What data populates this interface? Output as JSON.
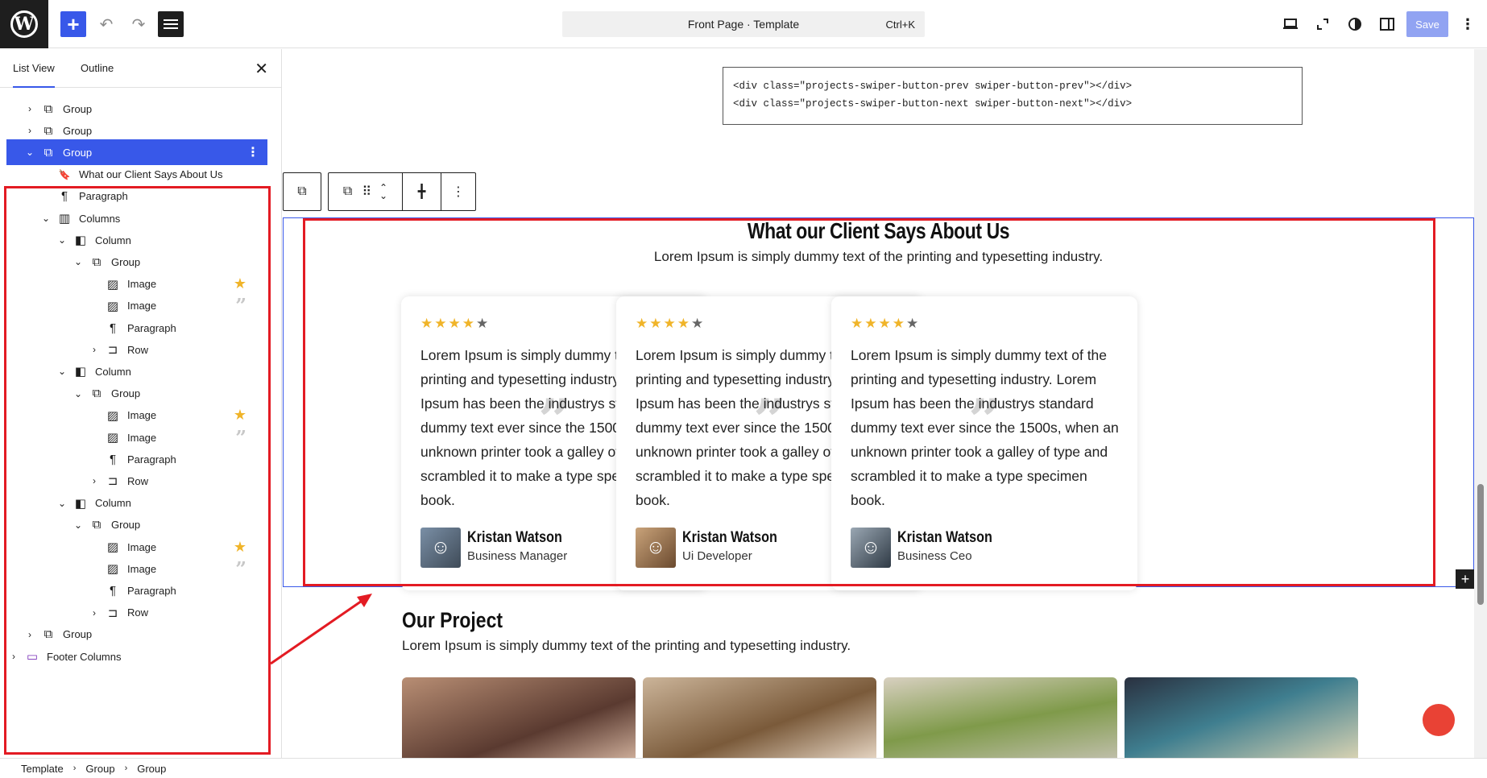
{
  "topbar": {
    "document_title": "Front Page · Template",
    "shortcut": "Ctrl+K",
    "save_label": "Save",
    "add_icon": "plus-icon",
    "undo_icon": "undo-icon",
    "redo_icon": "redo-icon"
  },
  "sidebar": {
    "tabs": [
      {
        "label": "List View"
      },
      {
        "label": "Outline"
      }
    ],
    "rows": [
      {
        "label": "Group",
        "depth": 0,
        "chev": "›",
        "icon": "group"
      },
      {
        "label": "Group",
        "depth": 0,
        "chev": "›",
        "icon": "group"
      },
      {
        "label": "Group",
        "depth": 0,
        "chev": "⌄",
        "icon": "group",
        "selected": true
      },
      {
        "label": "What our Client Says About Us",
        "depth": 1,
        "chev": "",
        "icon": "heading"
      },
      {
        "label": "Paragraph",
        "depth": 1,
        "chev": "",
        "icon": "paragraph"
      },
      {
        "label": "Columns",
        "depth": 1,
        "chev": "⌄",
        "icon": "columns"
      },
      {
        "label": "Column",
        "depth": 2,
        "chev": "⌄",
        "icon": "column"
      },
      {
        "label": "Group",
        "depth": 3,
        "chev": "⌄",
        "icon": "group"
      },
      {
        "label": "Image",
        "depth": 4,
        "chev": "",
        "icon": "image",
        "badge": "star"
      },
      {
        "label": "Image",
        "depth": 4,
        "chev": "",
        "icon": "image",
        "badge": "quote"
      },
      {
        "label": "Paragraph",
        "depth": 4,
        "chev": "",
        "icon": "paragraph"
      },
      {
        "label": "Row",
        "depth": 4,
        "chev": "›",
        "icon": "row"
      },
      {
        "label": "Column",
        "depth": 2,
        "chev": "⌄",
        "icon": "column"
      },
      {
        "label": "Group",
        "depth": 3,
        "chev": "⌄",
        "icon": "group"
      },
      {
        "label": "Image",
        "depth": 4,
        "chev": "",
        "icon": "image",
        "badge": "star"
      },
      {
        "label": "Image",
        "depth": 4,
        "chev": "",
        "icon": "image",
        "badge": "quote"
      },
      {
        "label": "Paragraph",
        "depth": 4,
        "chev": "",
        "icon": "paragraph"
      },
      {
        "label": "Row",
        "depth": 4,
        "chev": "›",
        "icon": "row"
      },
      {
        "label": "Column",
        "depth": 2,
        "chev": "⌄",
        "icon": "column"
      },
      {
        "label": "Group",
        "depth": 3,
        "chev": "⌄",
        "icon": "group"
      },
      {
        "label": "Image",
        "depth": 4,
        "chev": "",
        "icon": "image",
        "badge": "star"
      },
      {
        "label": "Image",
        "depth": 4,
        "chev": "",
        "icon": "image",
        "badge": "quote"
      },
      {
        "label": "Paragraph",
        "depth": 4,
        "chev": "",
        "icon": "paragraph"
      },
      {
        "label": "Row",
        "depth": 4,
        "chev": "›",
        "icon": "row"
      },
      {
        "label": "Group",
        "depth": 0,
        "chev": "›",
        "icon": "group"
      },
      {
        "label": "Footer Columns",
        "depth": -1,
        "chev": "›",
        "icon": "template-part"
      }
    ]
  },
  "breadcrumb": [
    "Template",
    "Group",
    "Group"
  ],
  "canvas": {
    "code_lines": [
      "<div class=\"projects-swiper-button-prev swiper-button-prev\"></div>",
      "<div class=\"projects-swiper-button-next swiper-button-next\"></div>"
    ],
    "testimonials": {
      "title": "What our Client Says About Us",
      "subtitle": "Lorem Ipsum is simply dummy text of the printing and typesetting industry.",
      "cards": [
        {
          "rating": 4,
          "text": "Lorem Ipsum is simply dummy text of the printing and typesetting industry. Lorem Ipsum has been the industrys standard dummy text ever since the 1500s, when an unknown printer took a galley of type and scrambled it to make a type specimen book.",
          "name": "Kristan Watson",
          "role": "Business Manager"
        },
        {
          "rating": 4,
          "text": "Lorem Ipsum is simply dummy text of the printing and typesetting industry. Lorem Ipsum has been the industrys standard dummy text ever since the 1500s, when an unknown printer took a galley of type and scrambled it to make a type specimen book.",
          "name": "Kristan Watson",
          "role": "Ui Developer"
        },
        {
          "rating": 4,
          "text": "Lorem Ipsum is simply dummy text of the printing and typesetting industry. Lorem Ipsum has been the industrys standard dummy text ever since the 1500s, when an unknown printer took a galley of type and scrambled it to make a type specimen book.",
          "name": "Kristan Watson",
          "role": "Business Ceo"
        }
      ]
    },
    "projects": {
      "title": "Our Project",
      "subtitle": "Lorem Ipsum is simply dummy text of the printing and typesetting industry."
    }
  },
  "colors": {
    "accent": "#3858e9",
    "highlight": "#e31b23",
    "star": "#f0b429"
  }
}
